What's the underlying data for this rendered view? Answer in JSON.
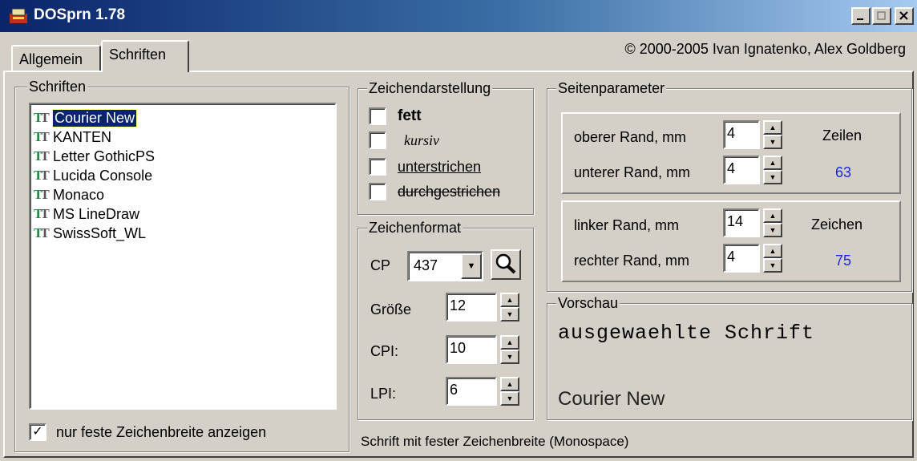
{
  "window": {
    "title": "DOSprn 1.78"
  },
  "copyright": "© 2000-2005 Ivan Ignatenko, Alex Goldberg",
  "tabs": [
    {
      "label": "Allgemein"
    },
    {
      "label": "Schriften"
    }
  ],
  "fonts_group": {
    "legend": "Schriften",
    "items": [
      "Courier New",
      "KANTEN",
      "Letter GothicPS",
      "Lucida Console",
      "Monaco",
      "MS LineDraw",
      "SwissSoft_WL"
    ],
    "selected": "Courier New",
    "fixed_only_label": "nur feste Zeichenbreite anzeigen",
    "fixed_only_checked": true
  },
  "style_group": {
    "legend": "Zeichendarstellung",
    "bold": "fett",
    "italic": "kursiv",
    "underline": "unterstrichen",
    "strike": "durchgestrichen"
  },
  "format_group": {
    "legend": "Zeichenformat",
    "cp_label": "CP",
    "cp_value": "437",
    "size_label": "Größe",
    "size_value": "12",
    "cpi_label": "CPI:",
    "cpi_value": "10",
    "lpi_label": "LPI:",
    "lpi_value": "6"
  },
  "page_group": {
    "legend": "Seitenparameter",
    "top_label": "oberer Rand, mm",
    "top_value": "4",
    "bottom_label": "unterer Rand, mm",
    "bottom_value": "4",
    "rows_label": "Zeilen",
    "rows_value": "63",
    "left_label": "linker Rand, mm",
    "left_value": "14",
    "right_label": "rechter Rand, mm",
    "right_value": "4",
    "chars_label": "Zeichen",
    "chars_value": "75",
    "value_color": "#1a2bd6"
  },
  "preview": {
    "legend": "Vorschau",
    "sample": "ausgewaehlte Schrift",
    "font_name": "Courier New"
  },
  "status": "Schrift mit fester Zeichenbreite (Monospace)"
}
